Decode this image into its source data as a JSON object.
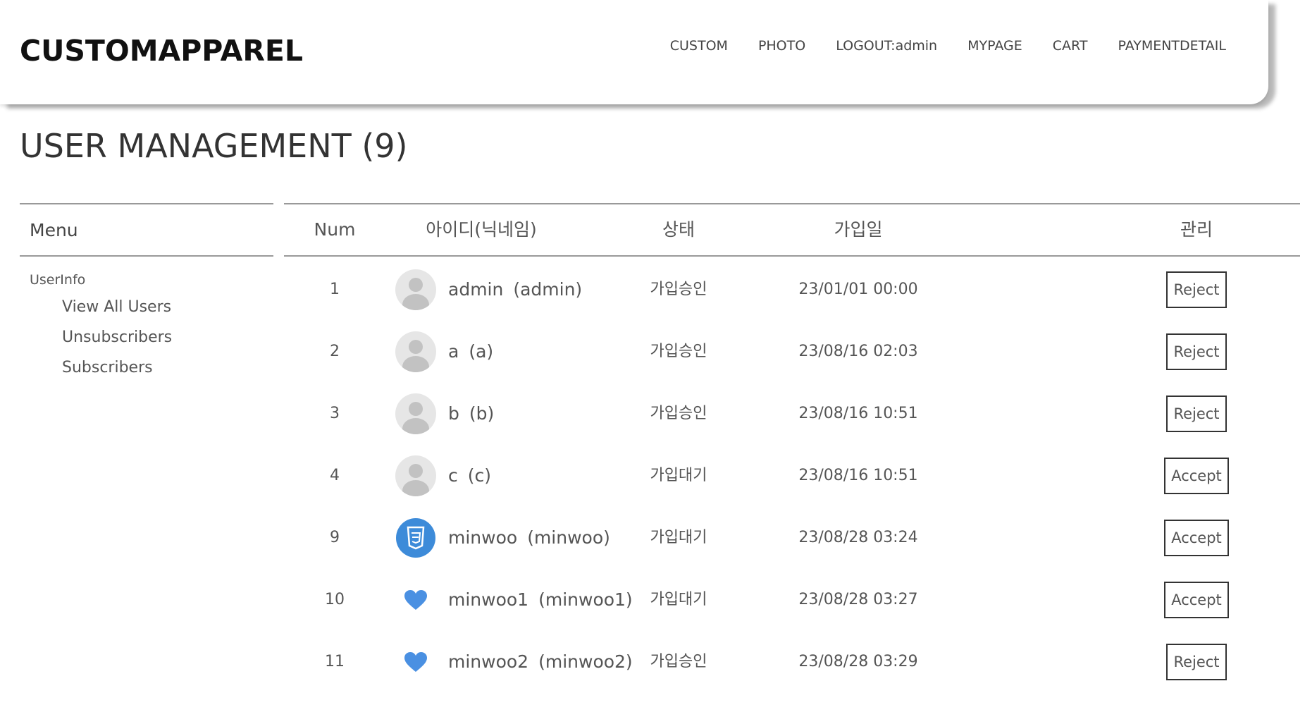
{
  "header": {
    "logo": "CUSTOMAPPAREL",
    "nav": [
      {
        "label": "CUSTOM",
        "name": "nav-custom"
      },
      {
        "label": "PHOTO",
        "name": "nav-photo"
      },
      {
        "label": "LOGOUT:admin",
        "name": "nav-logout"
      },
      {
        "label": "MYPAGE",
        "name": "nav-mypage"
      },
      {
        "label": "CART",
        "name": "nav-cart"
      },
      {
        "label": "PAYMENTDETAIL",
        "name": "nav-paymentdetail"
      }
    ]
  },
  "page": {
    "title": "USER MANAGEMENT (9)"
  },
  "sidebar": {
    "header": "Menu",
    "section": "UserInfo",
    "items": [
      {
        "label": "View All Users"
      },
      {
        "label": "Unsubscribers"
      },
      {
        "label": "Subscribers"
      }
    ]
  },
  "table": {
    "columns": {
      "num": "Num",
      "user": "아이디(닉네임)",
      "status": "상태",
      "joined": "가입일",
      "manage": "관리"
    },
    "rows": [
      {
        "num": "1",
        "id": "admin",
        "nick": "(admin)",
        "status": "가입승인",
        "date": "23/01/01 00:00",
        "action": "Reject",
        "avatar": "default-avatar-icon"
      },
      {
        "num": "2",
        "id": "a",
        "nick": "(a)",
        "status": "가입승인",
        "date": "23/08/16 02:03",
        "action": "Reject",
        "avatar": "default-avatar-icon"
      },
      {
        "num": "3",
        "id": "b",
        "nick": "(b)",
        "status": "가입승인",
        "date": "23/08/16 10:51",
        "action": "Reject",
        "avatar": "default-avatar-icon"
      },
      {
        "num": "4",
        "id": "c",
        "nick": "(c)",
        "status": "가입대기",
        "date": "23/08/16 10:51",
        "action": "Accept",
        "avatar": "default-avatar-icon"
      },
      {
        "num": "9",
        "id": "minwoo",
        "nick": "(minwoo)",
        "status": "가입대기",
        "date": "23/08/28 03:24",
        "action": "Accept",
        "avatar": "css3-badge-icon"
      },
      {
        "num": "10",
        "id": "minwoo1",
        "nick": "(minwoo1)",
        "status": "가입대기",
        "date": "23/08/28 03:27",
        "action": "Accept",
        "avatar": "heart-icon"
      },
      {
        "num": "11",
        "id": "minwoo2",
        "nick": "(minwoo2)",
        "status": "가입승인",
        "date": "23/08/28 03:29",
        "action": "Reject",
        "avatar": "heart-icon"
      }
    ]
  },
  "colors": {
    "accent_blue": "#3d8bd9",
    "heart_blue": "#4a90e2",
    "avatar_gray": "#c2c2c2",
    "divider": "#999999"
  }
}
